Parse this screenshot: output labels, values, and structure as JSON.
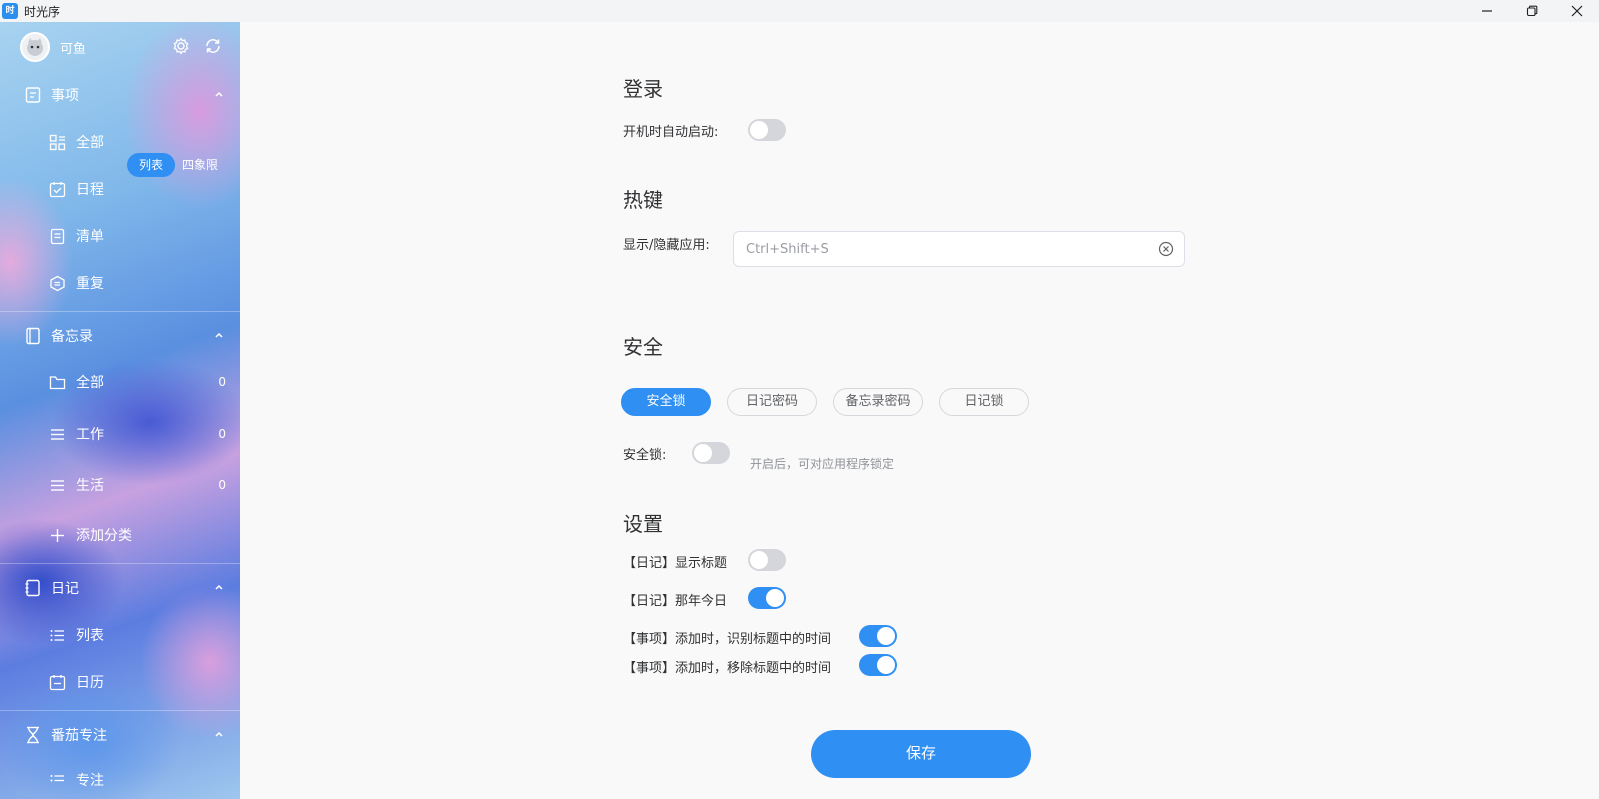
{
  "window": {
    "title": "时光序",
    "app_icon_text": "时"
  },
  "user": {
    "name": "可鱼"
  },
  "sidebar": {
    "sections": [
      {
        "label": "事项",
        "items": [
          {
            "label": "全部",
            "icon": "grid-icon"
          },
          {
            "label": "日程",
            "icon": "calendar-check-icon"
          },
          {
            "label": "清单",
            "icon": "checklist-icon"
          },
          {
            "label": "重复",
            "icon": "repeat-icon"
          }
        ]
      },
      {
        "label": "备忘录",
        "items": [
          {
            "label": "全部",
            "count": "0",
            "icon": "folder-icon"
          },
          {
            "label": "工作",
            "count": "0",
            "icon": "list-icon"
          },
          {
            "label": "生活",
            "count": "0",
            "icon": "list-icon"
          },
          {
            "label": "添加分类",
            "icon": "plus-icon"
          }
        ]
      },
      {
        "label": "日记",
        "items": [
          {
            "label": "列表",
            "icon": "bullet-list-icon"
          },
          {
            "label": "日历",
            "icon": "calendar-icon"
          }
        ]
      },
      {
        "label": "番茄专注",
        "items": [
          {
            "label": "专注"
          }
        ]
      }
    ],
    "view_toggle": {
      "active": "列表",
      "inactive": "四象限"
    }
  },
  "settings": {
    "login": {
      "title": "登录",
      "autostart_label": "开机时自动启动:",
      "autostart_on": false
    },
    "hotkey": {
      "title": "热键",
      "label": "显示/隐藏应用:",
      "value": "Ctrl+Shift+S"
    },
    "security": {
      "title": "安全",
      "tabs": [
        "安全锁",
        "日记密码",
        "备忘录密码",
        "日记锁"
      ],
      "active_tab": "安全锁",
      "lock_label": "安全锁:",
      "lock_on": false,
      "lock_hint": "开启后，可对应用程序锁定"
    },
    "general": {
      "title": "设置",
      "options": [
        {
          "label": "【日记】显示标题",
          "on": false
        },
        {
          "label": "【日记】那年今日",
          "on": true
        },
        {
          "label": "【事项】添加时，识别标题中的时间",
          "on": true
        },
        {
          "label": "【事项】添加时，移除标题中的时间",
          "on": true
        }
      ]
    },
    "save_label": "保存"
  },
  "colors": {
    "accent": "#2f8ff2",
    "toggle_off": "#d4d6db",
    "background": "#f9f9f9"
  }
}
